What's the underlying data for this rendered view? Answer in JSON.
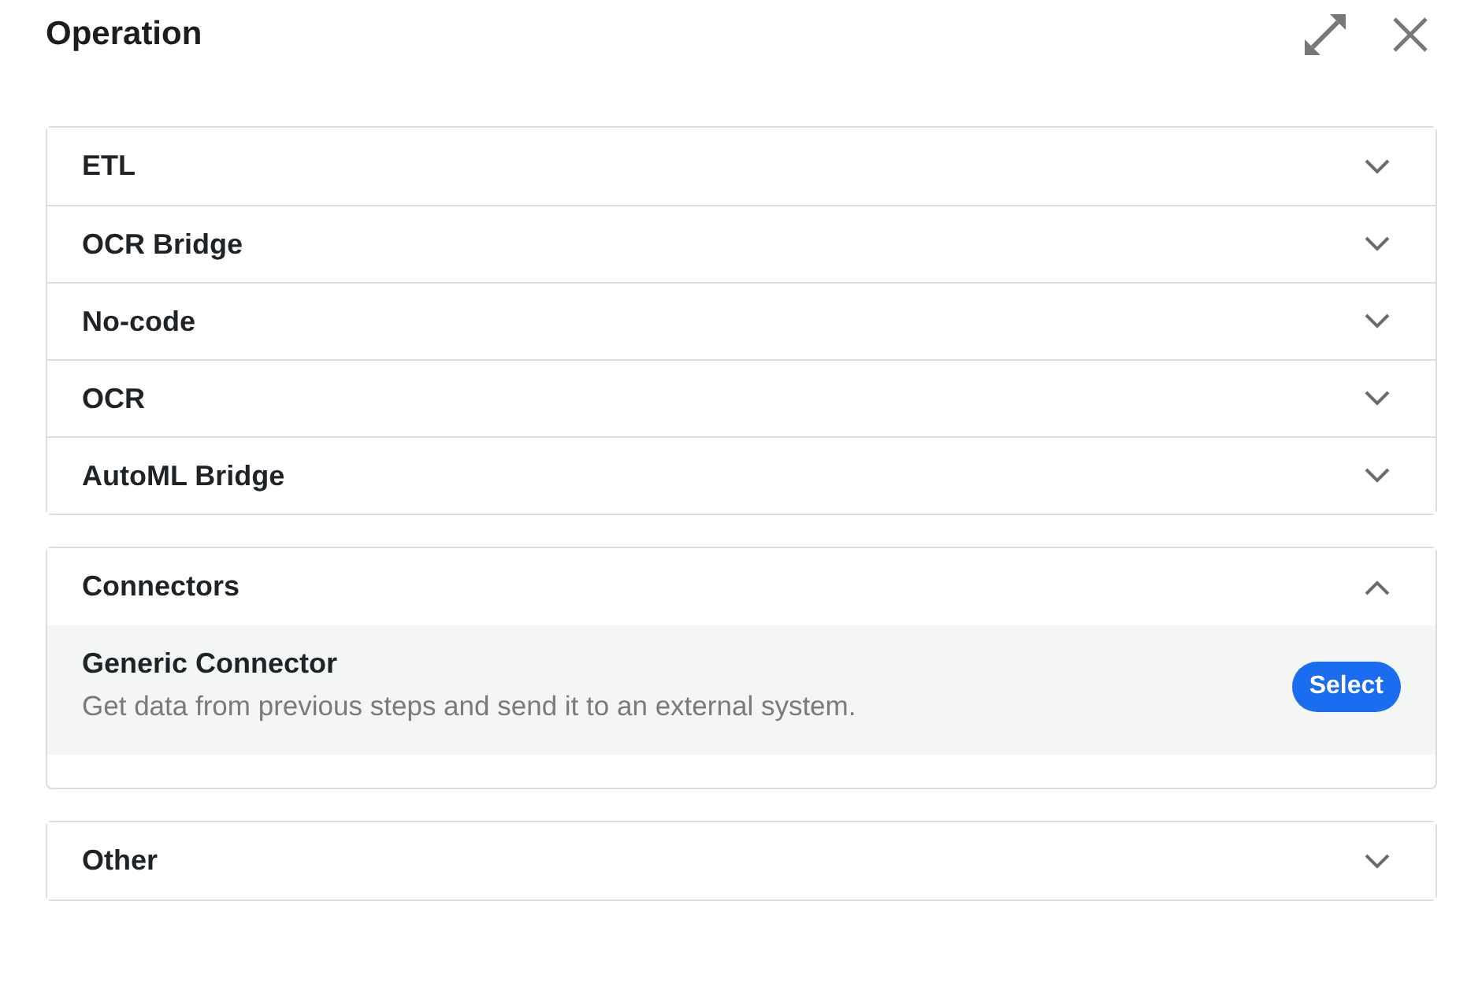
{
  "header": {
    "title": "Operation"
  },
  "cards": [
    {
      "sections": [
        {
          "label": "ETL",
          "expanded": false
        },
        {
          "label": "OCR Bridge",
          "expanded": false
        },
        {
          "label": "No-code",
          "expanded": false
        },
        {
          "label": "OCR",
          "expanded": false
        },
        {
          "label": "AutoML Bridge",
          "expanded": false
        }
      ]
    },
    {
      "sections": [
        {
          "label": "Connectors",
          "expanded": true,
          "items": [
            {
              "title": "Generic Connector",
              "description": "Get data from previous steps and send it to an external system.",
              "button": "Select"
            }
          ]
        }
      ]
    },
    {
      "sections": [
        {
          "label": "Other",
          "expanded": false
        }
      ]
    }
  ]
}
